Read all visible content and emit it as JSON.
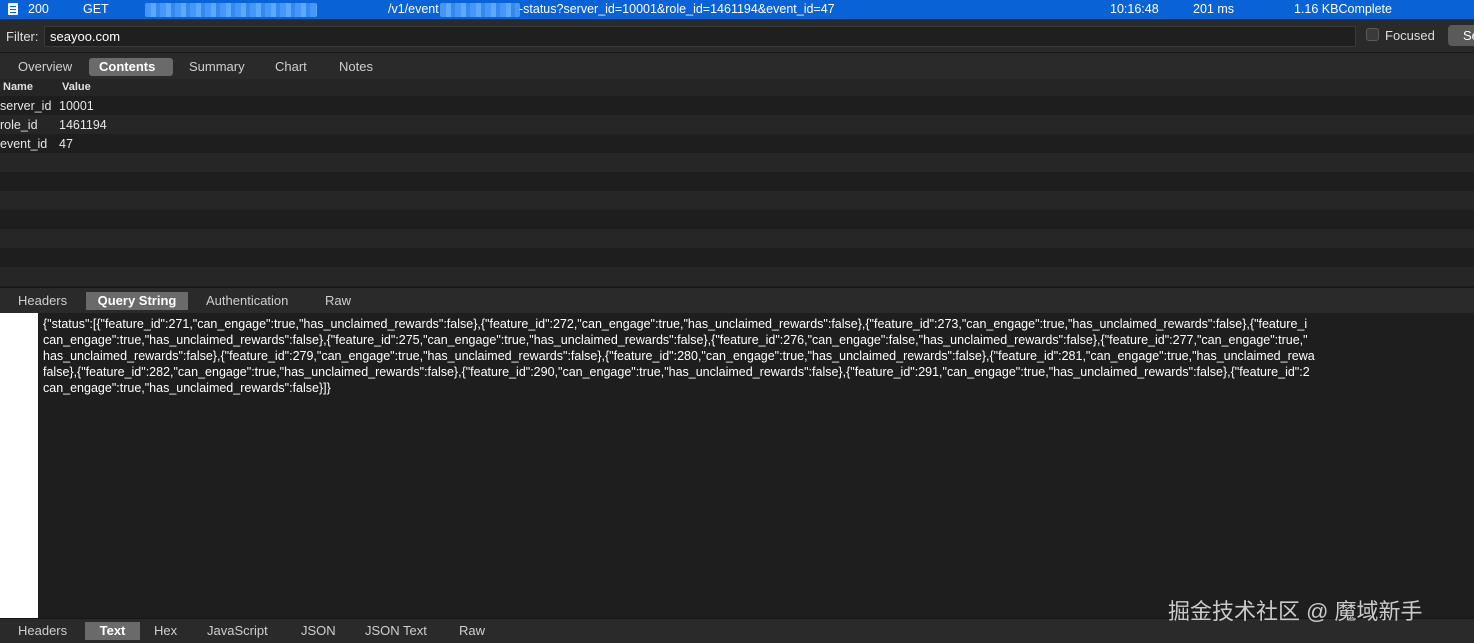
{
  "request": {
    "status": "200",
    "method": "GET",
    "path_prefix": "/v1/event",
    "path_suffix": "-status?server_id=10001&role_id=1461194&event_id=47",
    "time": "10:16:48",
    "duration": "201 ms",
    "size_state": "1.16 KBComplete"
  },
  "filter": {
    "label": "Filter:",
    "value": "seayoo.com",
    "focused_label": "Focused",
    "settings_label": "Se"
  },
  "top_tabs": [
    {
      "label": "Overview"
    },
    {
      "label": "Contents"
    },
    {
      "label": "Summary"
    },
    {
      "label": "Chart"
    },
    {
      "label": "Notes"
    }
  ],
  "table": {
    "col_name": "Name",
    "col_value": "Value",
    "rows": [
      {
        "name": "server_id",
        "value": "10001"
      },
      {
        "name": "role_id",
        "value": "1461194"
      },
      {
        "name": "event_id",
        "value": "47"
      }
    ]
  },
  "request_tabs": [
    {
      "label": "Headers"
    },
    {
      "label": "Query String"
    },
    {
      "label": "Authentication"
    },
    {
      "label": "Raw"
    }
  ],
  "response_body": [
    "{\"status\":[{\"feature_id\":271,\"can_engage\":true,\"has_unclaimed_rewards\":false},{\"feature_id\":272,\"can_engage\":true,\"has_unclaimed_rewards\":false},{\"feature_id\":273,\"can_engage\":true,\"has_unclaimed_rewards\":false},{\"feature_i",
    "can_engage\":true,\"has_unclaimed_rewards\":false},{\"feature_id\":275,\"can_engage\":true,\"has_unclaimed_rewards\":false},{\"feature_id\":276,\"can_engage\":false,\"has_unclaimed_rewards\":false},{\"feature_id\":277,\"can_engage\":true,\"",
    "has_unclaimed_rewards\":false},{\"feature_id\":279,\"can_engage\":true,\"has_unclaimed_rewards\":false},{\"feature_id\":280,\"can_engage\":true,\"has_unclaimed_rewards\":false},{\"feature_id\":281,\"can_engage\":true,\"has_unclaimed_rewa",
    "false},{\"feature_id\":282,\"can_engage\":true,\"has_unclaimed_rewards\":false},{\"feature_id\":290,\"can_engage\":true,\"has_unclaimed_rewards\":false},{\"feature_id\":291,\"can_engage\":true,\"has_unclaimed_rewards\":false},{\"feature_id\":2",
    "can_engage\":true,\"has_unclaimed_rewards\":false}]}"
  ],
  "response_tabs": [
    {
      "label": "Headers"
    },
    {
      "label": "Text"
    },
    {
      "label": "Hex"
    },
    {
      "label": "JavaScript"
    },
    {
      "label": "JSON"
    },
    {
      "label": "JSON Text"
    },
    {
      "label": "Raw"
    }
  ],
  "watermark": "掘金技术社区 @ 魔域新手",
  "colors": {
    "selected_row": "#0a63d6",
    "active_tab": "#6a6a6a",
    "panel_bg": "#1e1e1e"
  }
}
